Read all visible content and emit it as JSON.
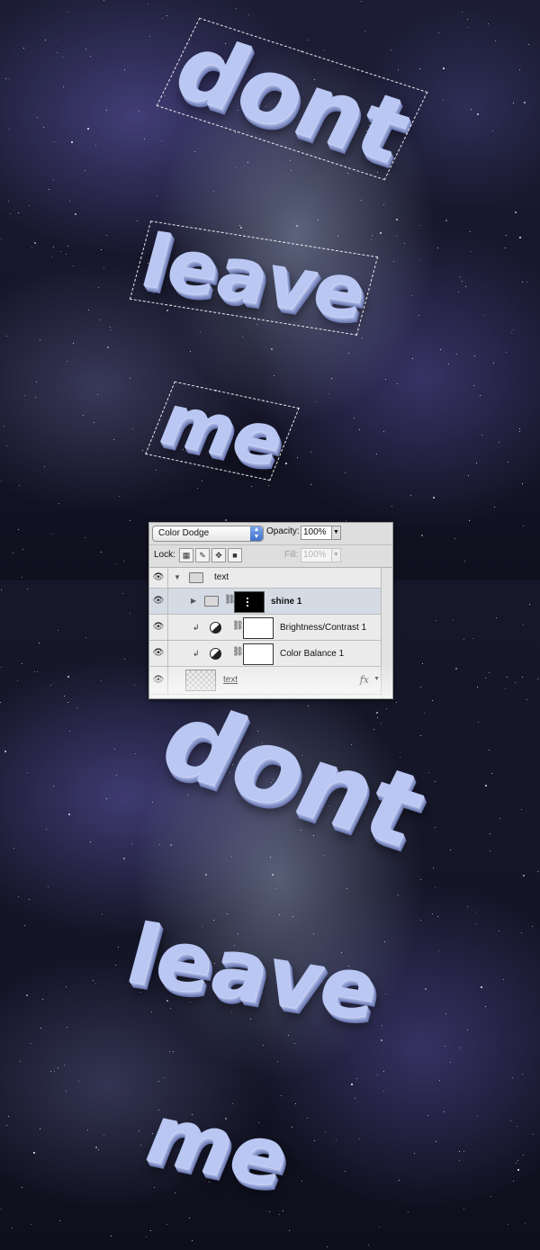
{
  "canvas_top": {
    "words": [
      "dont",
      "leave",
      "me"
    ],
    "selection_active": true
  },
  "canvas_bottom": {
    "words": [
      "dont",
      "leave",
      "me"
    ]
  },
  "layers_panel": {
    "blend_mode": "Color Dodge",
    "opacity_label": "Opacity:",
    "opacity_value": "100%",
    "lock_label": "Lock:",
    "fill_label": "Fill:",
    "fill_value": "100%",
    "layers": [
      {
        "name": "text",
        "type": "group",
        "expanded": true,
        "visible": true
      },
      {
        "name": "shine 1",
        "type": "group",
        "expanded": false,
        "visible": true,
        "selected": true,
        "has_mask": true
      },
      {
        "name": "Brightness/Contrast 1",
        "type": "adjustment",
        "clipped": true,
        "visible": true
      },
      {
        "name": "Color Balance 1",
        "type": "adjustment",
        "clipped": true,
        "visible": true
      },
      {
        "name": "text",
        "type": "layer",
        "has_fx": true,
        "visible": true
      }
    ],
    "icons": {
      "eye": "eye-icon",
      "folder": "folder-icon",
      "chain": "link-icon",
      "adjustment": "adjustment-layer-icon",
      "clip": "clipping-mask-icon",
      "fx": "fx-icon"
    }
  }
}
